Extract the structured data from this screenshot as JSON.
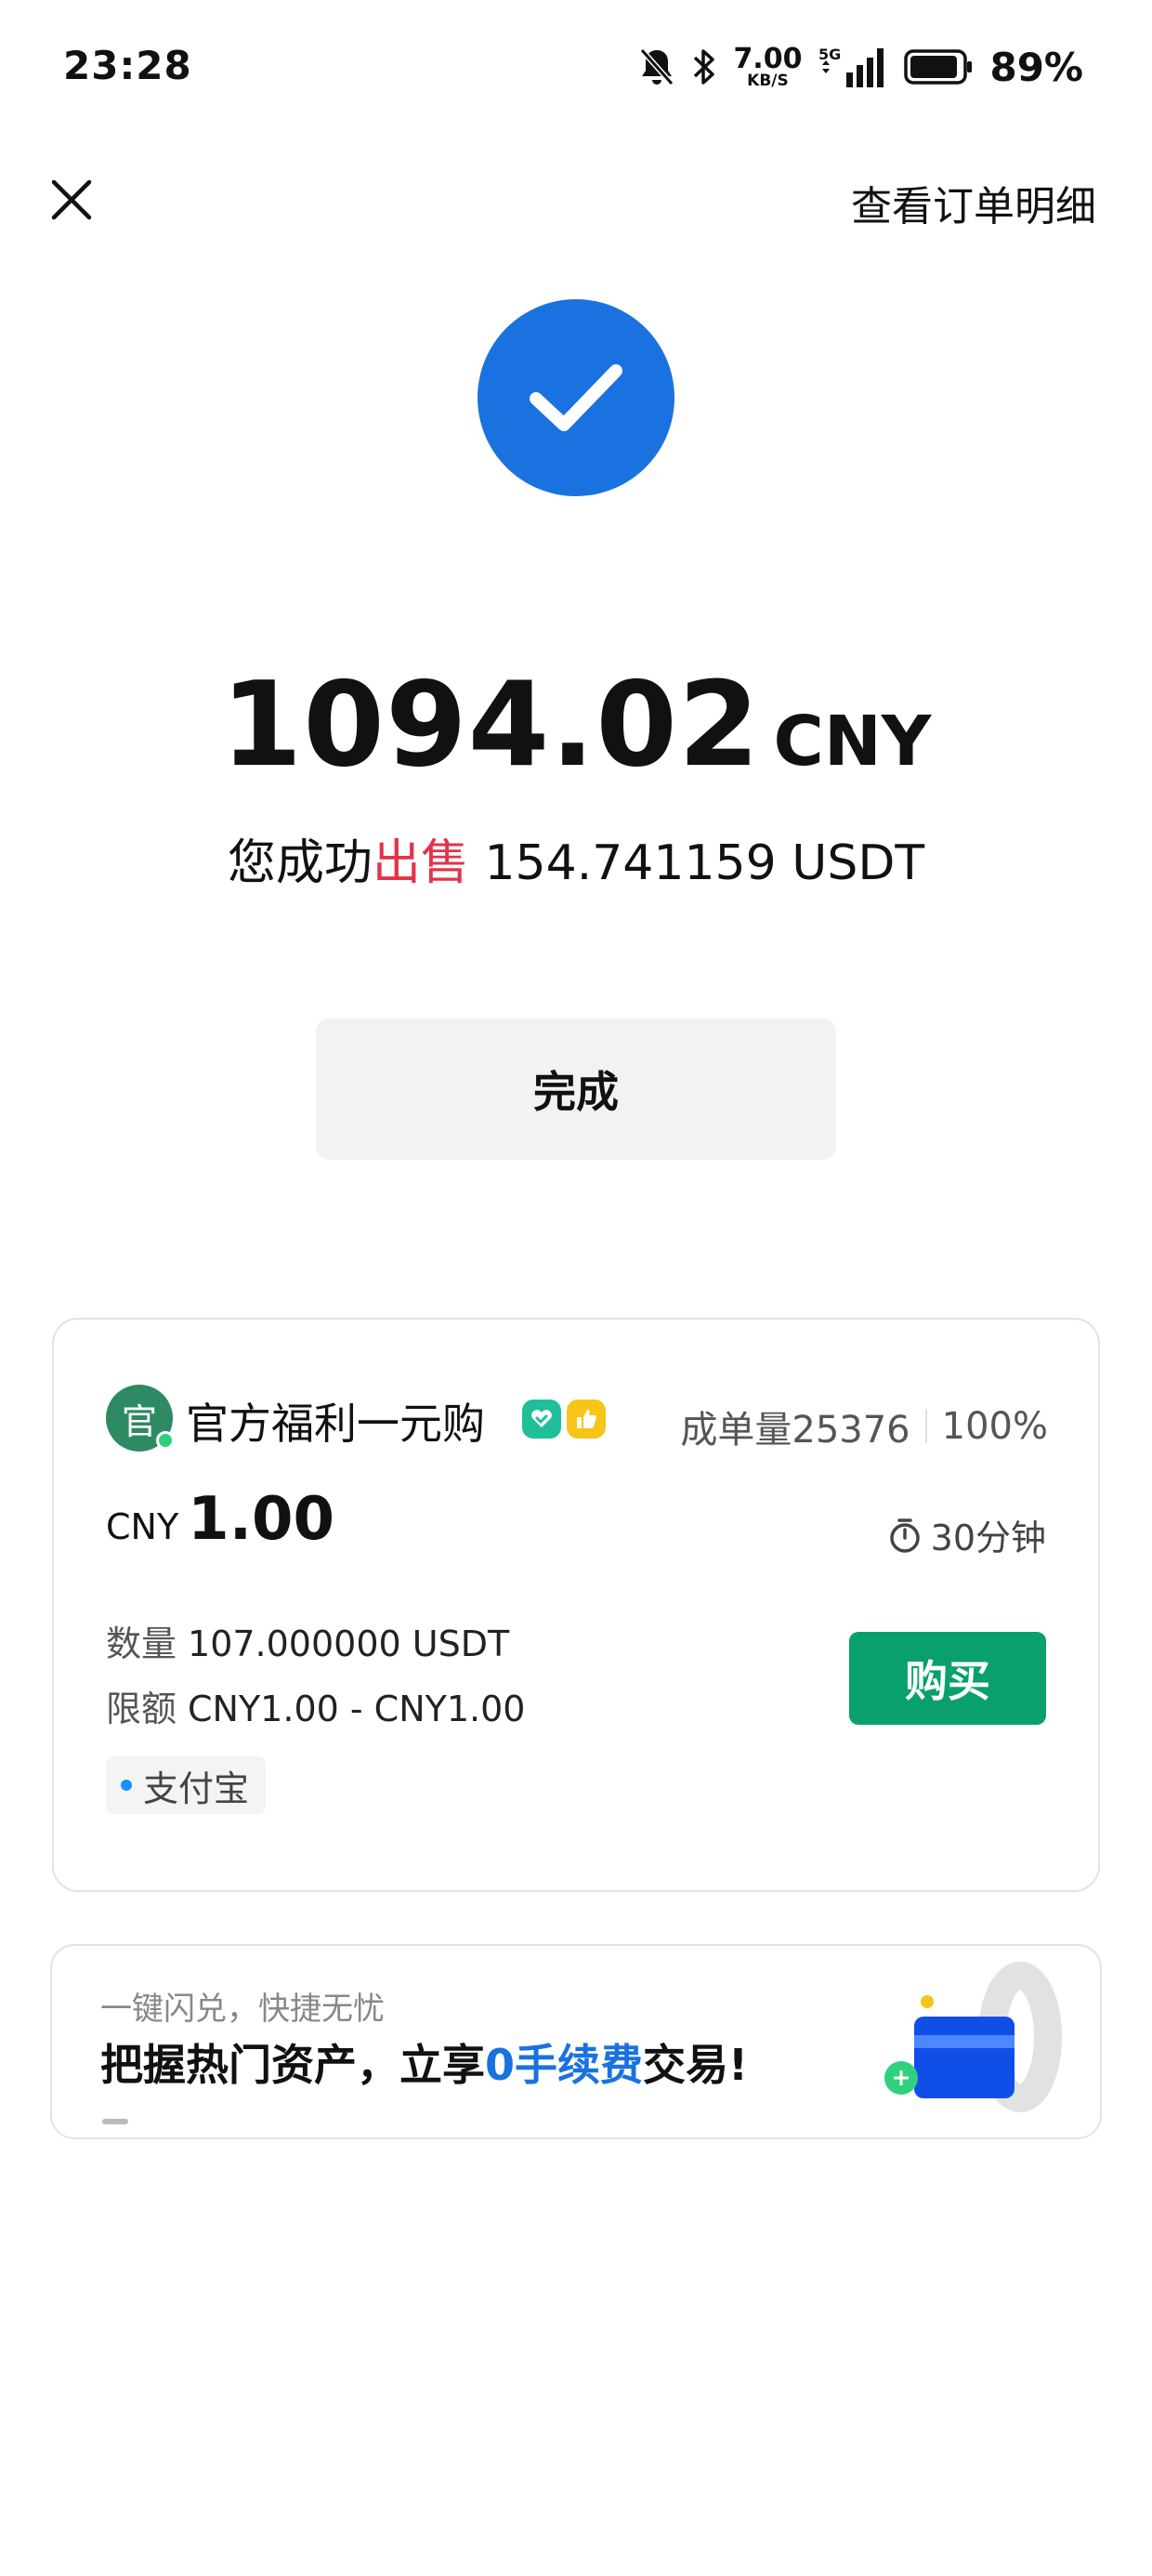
{
  "status_bar": {
    "time": "23:28",
    "net_speed_value": "7.00",
    "net_speed_unit": "KB/S",
    "network_type": "5G",
    "battery_percent": "89%",
    "icons": [
      "mute-icon",
      "bluetooth-icon",
      "signal-icon",
      "battery-icon"
    ]
  },
  "header": {
    "close_icon": "close-icon",
    "order_detail_link": "查看订单明细"
  },
  "result": {
    "icon": "check-icon",
    "color": "#1a72e0",
    "amount": "1094.02",
    "currency": "CNY",
    "sold_prefix": "您成功",
    "sold_action": "出售",
    "sold_amount": "154.741159 USDT",
    "done_button": "完成"
  },
  "merchant_card": {
    "avatar_text": "官",
    "name": "官方福利一元购",
    "badges": [
      "verified-badge-icon",
      "thumbs-up-badge-icon"
    ],
    "orders_label": "成单量25376",
    "completion_rate": "100%",
    "price_currency": "CNY",
    "price_value": "1.00",
    "time_limit": "30分钟",
    "quantity_label": "数量",
    "quantity_value": "107.000000 USDT",
    "limit_label": "限额",
    "limit_value": "CNY1.00 - CNY1.00",
    "buy_button": "购买",
    "buy_color": "#0aa06e",
    "payment_method": "支付宝"
  },
  "promo_banner": {
    "subtitle": "一键闪兑，快捷无忧",
    "title_before": "把握热门资产，立享",
    "title_highlight": "0手续费",
    "title_after": "交易!",
    "illustration": "card-illustration-icon"
  }
}
